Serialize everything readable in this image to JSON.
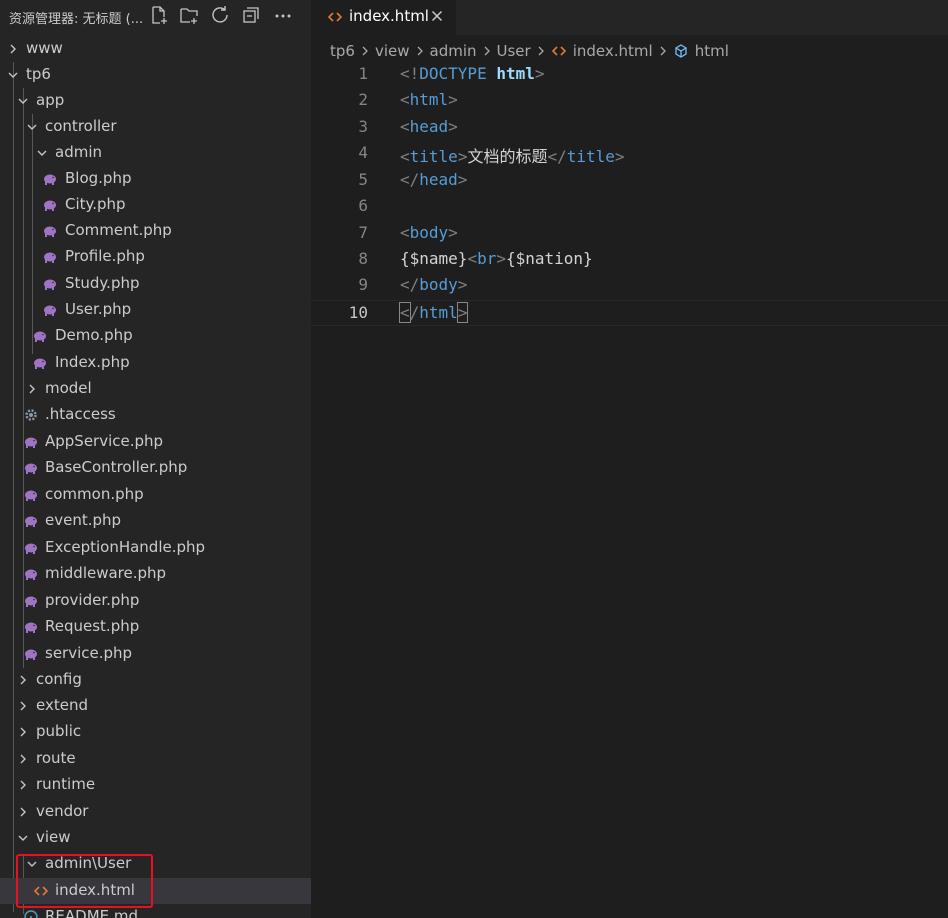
{
  "sidebar": {
    "title": "资源管理器: 无标题 (...",
    "header_icons": [
      "new-file-icon",
      "new-folder-icon",
      "refresh-icon",
      "collapse-all-icon",
      "more-actions-icon"
    ],
    "tree": [
      {
        "label": "www",
        "type": "folder",
        "expanded": false
      },
      {
        "label": "tp6",
        "type": "folder",
        "expanded": true
      },
      {
        "label": "app",
        "type": "folder",
        "expanded": true
      },
      {
        "label": "controller",
        "type": "folder",
        "expanded": true
      },
      {
        "label": "admin",
        "type": "folder",
        "expanded": true
      },
      {
        "label": "Blog.php",
        "type": "php"
      },
      {
        "label": "City.php",
        "type": "php"
      },
      {
        "label": "Comment.php",
        "type": "php"
      },
      {
        "label": "Profile.php",
        "type": "php"
      },
      {
        "label": "Study.php",
        "type": "php"
      },
      {
        "label": "User.php",
        "type": "php"
      },
      {
        "label": "Demo.php",
        "type": "php"
      },
      {
        "label": "Index.php",
        "type": "php"
      },
      {
        "label": "model",
        "type": "folder",
        "expanded": false
      },
      {
        "label": ".htaccess",
        "type": "config"
      },
      {
        "label": "AppService.php",
        "type": "php"
      },
      {
        "label": "BaseController.php",
        "type": "php"
      },
      {
        "label": "common.php",
        "type": "php"
      },
      {
        "label": "event.php",
        "type": "php"
      },
      {
        "label": "ExceptionHandle.php",
        "type": "php"
      },
      {
        "label": "middleware.php",
        "type": "php"
      },
      {
        "label": "provider.php",
        "type": "php"
      },
      {
        "label": "Request.php",
        "type": "php"
      },
      {
        "label": "service.php",
        "type": "php"
      },
      {
        "label": "config",
        "type": "folder",
        "expanded": false
      },
      {
        "label": "extend",
        "type": "folder",
        "expanded": false
      },
      {
        "label": "public",
        "type": "folder",
        "expanded": false
      },
      {
        "label": "route",
        "type": "folder",
        "expanded": false
      },
      {
        "label": "runtime",
        "type": "folder",
        "expanded": false
      },
      {
        "label": "vendor",
        "type": "folder",
        "expanded": false
      },
      {
        "label": "view",
        "type": "folder",
        "expanded": true
      },
      {
        "label": "admin\\User",
        "type": "folder",
        "expanded": true
      },
      {
        "label": "index.html",
        "type": "html",
        "selected": true
      },
      {
        "label": "README.md",
        "type": "info"
      }
    ]
  },
  "editor": {
    "tab": {
      "label": "index.html",
      "close_icon": "close-icon"
    },
    "breadcrumb": [
      "tp6",
      "view",
      "admin",
      "User",
      "index.html",
      "html"
    ],
    "lines": [
      {
        "num": "1"
      },
      {
        "num": "2"
      },
      {
        "num": "3"
      },
      {
        "num": "4"
      },
      {
        "num": "5"
      },
      {
        "num": "6"
      },
      {
        "num": "7"
      },
      {
        "num": "8"
      },
      {
        "num": "9"
      },
      {
        "num": "10"
      }
    ],
    "code": {
      "l1": [
        "<!",
        "DOCTYPE",
        "html",
        ">"
      ],
      "l2": [
        "<",
        "html",
        ">"
      ],
      "l3": [
        "<",
        "head",
        ">"
      ],
      "l4": [
        "<",
        "title",
        ">",
        "文档的标题",
        "</",
        "title",
        ">"
      ],
      "l5": [
        "</",
        "head",
        ">"
      ],
      "l7": [
        "<",
        "body",
        ">"
      ],
      "l8": [
        "{$name}",
        "<",
        "br",
        ">",
        "{$nation}"
      ],
      "l9": [
        "</",
        "body",
        ">"
      ],
      "l10": [
        "<",
        "/",
        "html",
        ">"
      ]
    }
  },
  "colors": {
    "sidebar_bg": "#252526",
    "editor_bg": "#1e1e1e",
    "tag": "#569cd6",
    "punct": "#808080",
    "php_icon": "#a074c4",
    "html_icon": "#e37933",
    "highlight_box": "#e81123"
  }
}
